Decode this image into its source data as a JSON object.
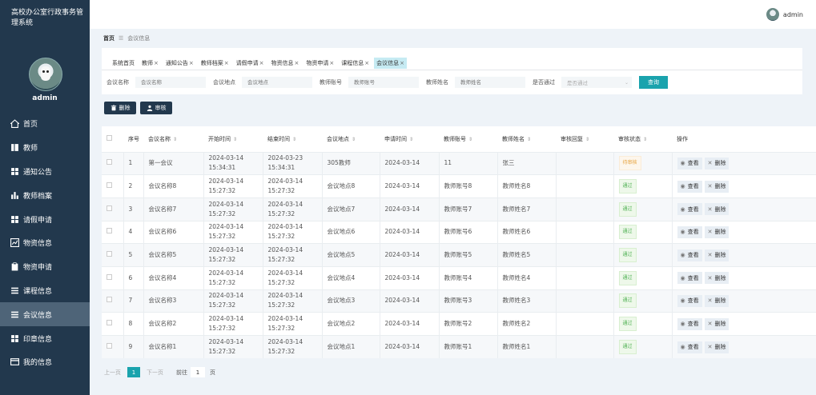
{
  "app": {
    "title": "高校办公室行政事务管理系统",
    "username": "admin"
  },
  "topbar": {
    "username": "admin"
  },
  "sidebar": {
    "items": [
      {
        "label": "首页",
        "icon": "home-icon"
      },
      {
        "label": "教师",
        "icon": "book-icon"
      },
      {
        "label": "通知公告",
        "icon": "grid-icon"
      },
      {
        "label": "教师档案",
        "icon": "bar-chart-icon"
      },
      {
        "label": "请假申请",
        "icon": "grid-icon"
      },
      {
        "label": "物资信息",
        "icon": "trend-chart-icon"
      },
      {
        "label": "物资申请",
        "icon": "clipboard-icon"
      },
      {
        "label": "课程信息",
        "icon": "list-icon"
      },
      {
        "label": "会议信息",
        "icon": "menu-icon",
        "active": true
      },
      {
        "label": "印章信息",
        "icon": "grid-icon"
      },
      {
        "label": "我的信息",
        "icon": "card-icon"
      }
    ]
  },
  "breadcrumb": {
    "home": "首页",
    "current": "会议信息"
  },
  "tabs": [
    {
      "label": "系统首页",
      "closable": false
    },
    {
      "label": "教师",
      "closable": true
    },
    {
      "label": "通知公告",
      "closable": true
    },
    {
      "label": "教师档案",
      "closable": true
    },
    {
      "label": "请假申请",
      "closable": true
    },
    {
      "label": "物资信息",
      "closable": true
    },
    {
      "label": "物资申请",
      "closable": true
    },
    {
      "label": "课程信息",
      "closable": true
    },
    {
      "label": "会议信息",
      "closable": true,
      "active": true
    }
  ],
  "search": {
    "meeting_name_label": "会议名称",
    "meeting_name_placeholder": "会议名称",
    "meeting_place_label": "会议地点",
    "meeting_place_placeholder": "会议地点",
    "teacher_account_label": "教师账号",
    "teacher_account_placeholder": "教师账号",
    "teacher_name_label": "教师姓名",
    "teacher_name_placeholder": "教师姓名",
    "approved_label": "是否通过",
    "approved_placeholder": "是否通过",
    "query_button": "查询"
  },
  "actions": {
    "delete_label": "删除",
    "review_label": "审核"
  },
  "table": {
    "columns": [
      "序号",
      "会议名称",
      "开始时间",
      "结束时间",
      "会议地点",
      "申请时间",
      "教师账号",
      "教师姓名",
      "审核回复",
      "审核状态",
      "操作"
    ],
    "view_label": "查看",
    "delete_label": "删除",
    "rows": [
      {
        "idx": "1",
        "name": "第一会议",
        "start": "2024-03-14 15:34:31",
        "end": "2024-03-23 15:34:31",
        "place": "305教师",
        "apply": "2024-03-14",
        "account": "11",
        "tname": "张三",
        "reply": "",
        "status": "待审核",
        "status_type": "pending"
      },
      {
        "idx": "2",
        "name": "会议名称8",
        "start": "2024-03-14 15:27:32",
        "end": "2024-03-14 15:27:32",
        "place": "会议地点8",
        "apply": "2024-03-14",
        "account": "教师账号8",
        "tname": "教师姓名8",
        "reply": "",
        "status": "通过",
        "status_type": "pass"
      },
      {
        "idx": "3",
        "name": "会议名称7",
        "start": "2024-03-14 15:27:32",
        "end": "2024-03-14 15:27:32",
        "place": "会议地点7",
        "apply": "2024-03-14",
        "account": "教师账号7",
        "tname": "教师姓名7",
        "reply": "",
        "status": "通过",
        "status_type": "pass"
      },
      {
        "idx": "4",
        "name": "会议名称6",
        "start": "2024-03-14 15:27:32",
        "end": "2024-03-14 15:27:32",
        "place": "会议地点6",
        "apply": "2024-03-14",
        "account": "教师账号6",
        "tname": "教师姓名6",
        "reply": "",
        "status": "通过",
        "status_type": "pass"
      },
      {
        "idx": "5",
        "name": "会议名称5",
        "start": "2024-03-14 15:27:32",
        "end": "2024-03-14 15:27:32",
        "place": "会议地点5",
        "apply": "2024-03-14",
        "account": "教师账号5",
        "tname": "教师姓名5",
        "reply": "",
        "status": "通过",
        "status_type": "pass"
      },
      {
        "idx": "6",
        "name": "会议名称4",
        "start": "2024-03-14 15:27:32",
        "end": "2024-03-14 15:27:32",
        "place": "会议地点4",
        "apply": "2024-03-14",
        "account": "教师账号4",
        "tname": "教师姓名4",
        "reply": "",
        "status": "通过",
        "status_type": "pass"
      },
      {
        "idx": "7",
        "name": "会议名称3",
        "start": "2024-03-14 15:27:32",
        "end": "2024-03-14 15:27:32",
        "place": "会议地点3",
        "apply": "2024-03-14",
        "account": "教师账号3",
        "tname": "教师姓名3",
        "reply": "",
        "status": "通过",
        "status_type": "pass"
      },
      {
        "idx": "8",
        "name": "会议名称2",
        "start": "2024-03-14 15:27:32",
        "end": "2024-03-14 15:27:32",
        "place": "会议地点2",
        "apply": "2024-03-14",
        "account": "教师账号2",
        "tname": "教师姓名2",
        "reply": "",
        "status": "通过",
        "status_type": "pass"
      },
      {
        "idx": "9",
        "name": "会议名称1",
        "start": "2024-03-14 15:27:32",
        "end": "2024-03-14 15:27:32",
        "place": "会议地点1",
        "apply": "2024-03-14",
        "account": "教师账号1",
        "tname": "教师姓名1",
        "reply": "",
        "status": "通过",
        "status_type": "pass"
      }
    ]
  },
  "pager": {
    "prev": "上一页",
    "current": "1",
    "next": "下一页",
    "goto": "前往",
    "goto_value": "1",
    "suffix": "页"
  },
  "colors": {
    "sidebar_bg": "#22384d",
    "accent": "#1aa3ad",
    "active_menu": "#4e6478"
  }
}
